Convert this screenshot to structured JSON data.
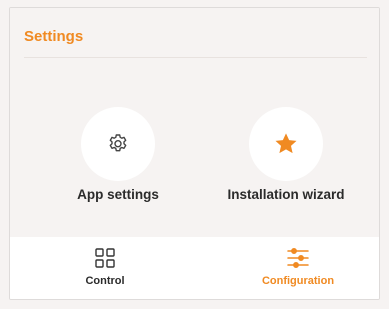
{
  "header": {
    "title": "Settings"
  },
  "tiles": [
    {
      "label": "App settings",
      "icon": "gear-icon"
    },
    {
      "label": "Installation wizard",
      "icon": "star-icon"
    }
  ],
  "bottom_nav": [
    {
      "label": "Control",
      "icon": "grid-icon",
      "active": false
    },
    {
      "label": "Configuration",
      "icon": "sliders-icon",
      "active": true
    }
  ],
  "colors": {
    "accent": "#f08a22",
    "text": "#2b2b2b",
    "background": "#f6f3f2"
  }
}
